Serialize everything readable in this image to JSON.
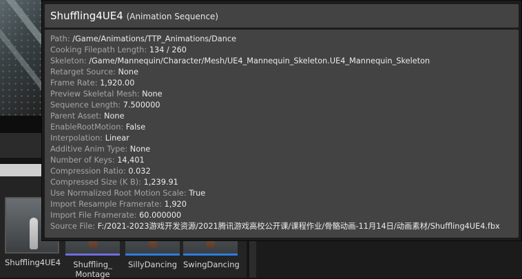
{
  "asset": {
    "name": "Shuffling4UE4",
    "type": "(Animation Sequence)"
  },
  "properties": [
    {
      "key": "Path:",
      "value": "/Game/Animations/TTP_Animations/Dance"
    },
    {
      "key": "Cooking Filepath Length:",
      "value": "134 / 260"
    },
    {
      "key": "Skeleton:",
      "value": "/Game/Mannequin/Character/Mesh/UE4_Mannequin_Skeleton.UE4_Mannequin_Skeleton"
    },
    {
      "key": "Retarget Source:",
      "value": "None"
    },
    {
      "key": "Frame Rate:",
      "value": "1,920.00"
    },
    {
      "key": "Preview Skeletal Mesh:",
      "value": "None"
    },
    {
      "key": "Sequence Length:",
      "value": "7.500000"
    },
    {
      "key": "Parent Asset:",
      "value": "None"
    },
    {
      "key": "EnableRootMotion:",
      "value": "False"
    },
    {
      "key": "Interpolation:",
      "value": "Linear"
    },
    {
      "key": "Additive Anim Type:",
      "value": "None"
    },
    {
      "key": "Number of Keys:",
      "value": "14,401"
    },
    {
      "key": "Compression Ratio:",
      "value": "0.032"
    },
    {
      "key": "Compressed Size (K B):",
      "value": "1,239.91"
    },
    {
      "key": "Use Normalized Root Motion Scale:",
      "value": "True"
    },
    {
      "key": "Import Resample Framerate:",
      "value": "1,920"
    },
    {
      "key": "Import File Framerate:",
      "value": "60.000000"
    },
    {
      "key": "Source File:",
      "value": "F:/2021-2023游戏开发资源/2021腾讯游戏高校公开课/课程作业/骨骼动画-11月14日/动画素材/Shuffling4UE4.fbx"
    }
  ],
  "content_browser": {
    "assets": [
      {
        "line1": "Shuffling4UE4",
        "line2": ""
      },
      {
        "line1": "Shuffling_",
        "line2": "Montage"
      },
      {
        "line1": "SillyDancing",
        "line2": ""
      },
      {
        "line1": "SwingDancing",
        "line2": ""
      }
    ]
  }
}
